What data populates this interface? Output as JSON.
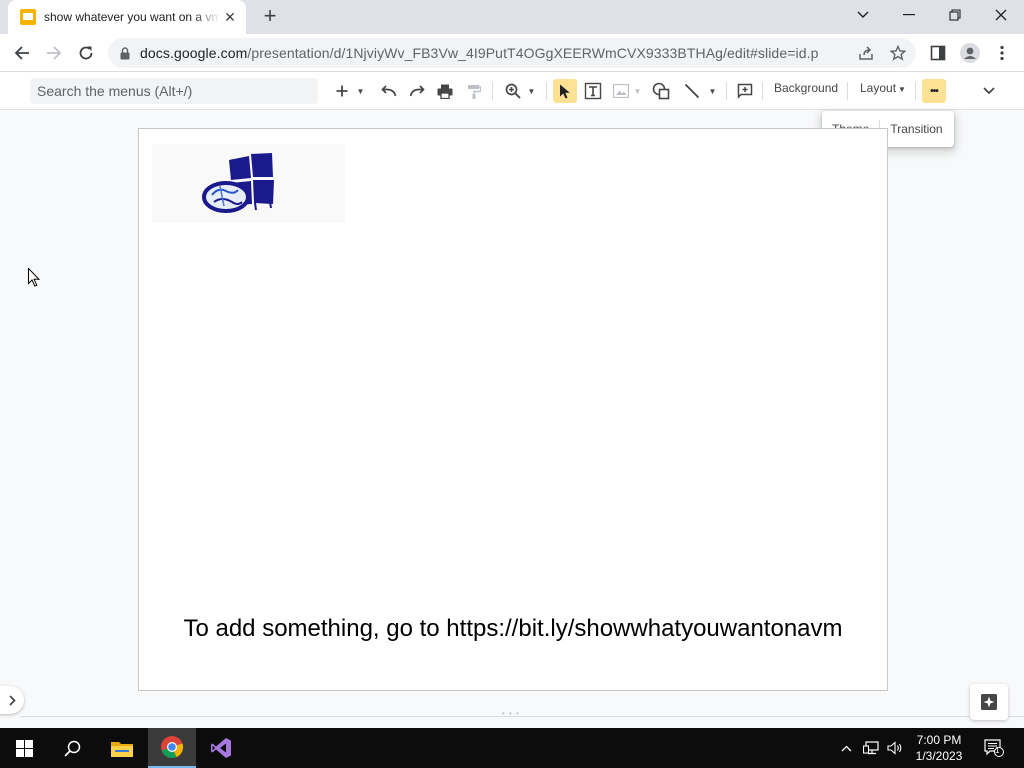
{
  "browser": {
    "tab_title": "show whatever you want on a vm",
    "url_host": "docs.google.com",
    "url_path": "/presentation/d/1NjviyWv_FB3Vw_4I9PutT4OGgXEERWmCVX9333BTHAg/edit#slide=id.p"
  },
  "toolbar": {
    "search_placeholder": "Search the menus (Alt+/)",
    "background_label": "Background",
    "layout_label": "Layout",
    "more_label": "•••"
  },
  "more_menu": {
    "theme_label": "Theme",
    "transition_label": "Transition"
  },
  "slide": {
    "text": "To add something, go to https://bit.ly/showwhatyouwantonavm"
  },
  "taskbar": {
    "time": "7:00 PM",
    "date": "1/3/2023",
    "notification_count": "1"
  },
  "colors": {
    "accent_selected": "#fde293",
    "drawing_blue": "#1a1a8c",
    "taskbar": "#0c0c0c"
  }
}
